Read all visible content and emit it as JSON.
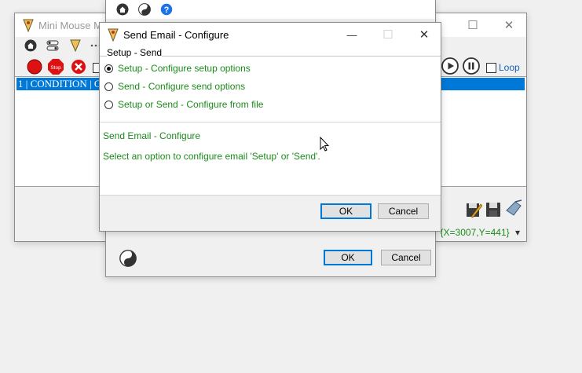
{
  "main_window": {
    "title": "Mini Mouse M",
    "list_row": "1 | CONDITION | C",
    "loop_label": "Loop",
    "coords": "{X=3007,Y=441}",
    "coords_arrow": "▾"
  },
  "bg_dialog": {
    "ok_label": "OK",
    "cancel_label": "Cancel"
  },
  "dialog": {
    "title": "Send Email - Configure",
    "minimize": "—",
    "maximize": "☐",
    "close": "✕",
    "group_title": "Setup - Send",
    "options": [
      {
        "label": "Setup - Configure setup options",
        "selected": true
      },
      {
        "label": "Send - Configure send options",
        "selected": false
      },
      {
        "label": "Setup or Send - Configure from file",
        "selected": false
      }
    ],
    "info_title": "Send Email - Configure",
    "info_description": "Select an option to configure email 'Setup' or 'Send'.",
    "ok_label": "OK",
    "cancel_label": "Cancel"
  },
  "colors": {
    "accent": "#0078d7",
    "text_green": "#1c8b1c",
    "selection": "#0078d7"
  }
}
